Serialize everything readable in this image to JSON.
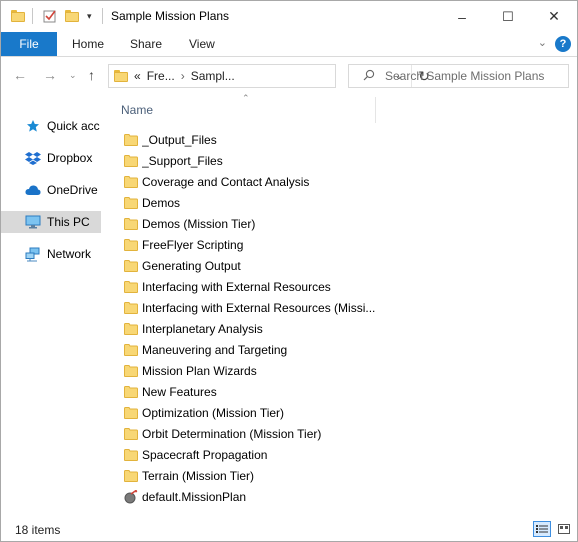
{
  "window": {
    "title": "Sample Mission Plans",
    "minimize": "–",
    "maximize": "☐",
    "close": "✕"
  },
  "ribbon": {
    "tabs": [
      "File",
      "Home",
      "Share",
      "View"
    ],
    "help": "?"
  },
  "address": {
    "parts": [
      "«",
      "Fre...",
      "›",
      "Sampl..."
    ],
    "search_placeholder": "Search Sample Mission Plans"
  },
  "nav_pane": {
    "items": [
      {
        "label": "Quick acc",
        "icon": "star-icon"
      },
      {
        "label": "Dropbox",
        "icon": "dropbox-icon"
      },
      {
        "label": "OneDrive",
        "icon": "cloud-icon"
      },
      {
        "label": "This PC",
        "icon": "computer-icon",
        "selected": true
      },
      {
        "label": "Network",
        "icon": "network-icon"
      }
    ]
  },
  "file_list": {
    "column_header": "Name",
    "items": [
      {
        "name": "_Output_Files",
        "type": "folder"
      },
      {
        "name": "_Support_Files",
        "type": "folder"
      },
      {
        "name": "Coverage and Contact Analysis",
        "type": "folder"
      },
      {
        "name": "Demos",
        "type": "folder"
      },
      {
        "name": "Demos (Mission Tier)",
        "type": "folder"
      },
      {
        "name": "FreeFlyer Scripting",
        "type": "folder"
      },
      {
        "name": "Generating Output",
        "type": "folder"
      },
      {
        "name": "Interfacing with External Resources",
        "type": "folder"
      },
      {
        "name": "Interfacing with External Resources (Missi...",
        "type": "folder"
      },
      {
        "name": "Interplanetary Analysis",
        "type": "folder"
      },
      {
        "name": "Maneuvering and Targeting",
        "type": "folder"
      },
      {
        "name": "Mission Plan Wizards",
        "type": "folder"
      },
      {
        "name": "New Features",
        "type": "folder"
      },
      {
        "name": "Optimization (Mission Tier)",
        "type": "folder"
      },
      {
        "name": "Orbit Determination (Mission Tier)",
        "type": "folder"
      },
      {
        "name": "Spacecraft Propagation",
        "type": "folder"
      },
      {
        "name": "Terrain (Mission Tier)",
        "type": "folder"
      },
      {
        "name": "default.MissionPlan",
        "type": "missionplan"
      }
    ]
  },
  "status_bar": {
    "item_count": "18 items"
  },
  "colors": {
    "accent": "#1979ca",
    "folder": "#f8d775",
    "selected_nav": "#d9d9d9"
  }
}
